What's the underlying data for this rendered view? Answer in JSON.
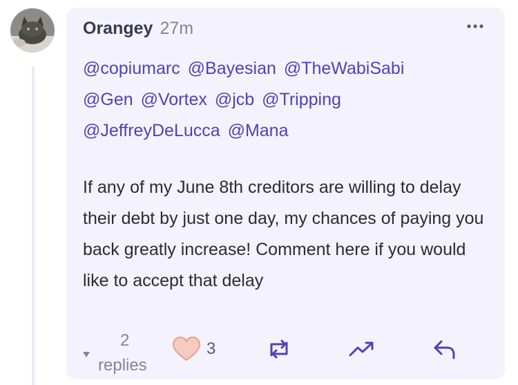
{
  "comment": {
    "author": "Orangey",
    "time": "27m",
    "mentions": [
      "@copiumarc",
      "@Bayesian",
      "@TheWabiSabi",
      "@Gen",
      "@Vortex",
      "@jcb",
      "@Tripping",
      "@JeffreyDeLucca",
      "@Mana"
    ],
    "body": "If any of my June 8th creditors are willing to delay their debt by just one day, my chances of paying you back greatly increase! Comment here if you would like to accept that delay",
    "replies_count": "2",
    "replies_label": "replies",
    "likes_count": "3"
  },
  "icons": {
    "more": "more-dots-icon",
    "like": "heart-icon",
    "repost": "repost-icon",
    "trending": "trending-up-icon",
    "reply": "reply-arrow-icon",
    "caret": "caret-down-icon"
  },
  "colors": {
    "card_bg": "#f4f3fd",
    "mention": "#4d43b9",
    "heart_fill": "#f6cbc0",
    "heart_stroke": "#e9a48f",
    "icon": "#4d43b9",
    "muted": "#86858f"
  }
}
